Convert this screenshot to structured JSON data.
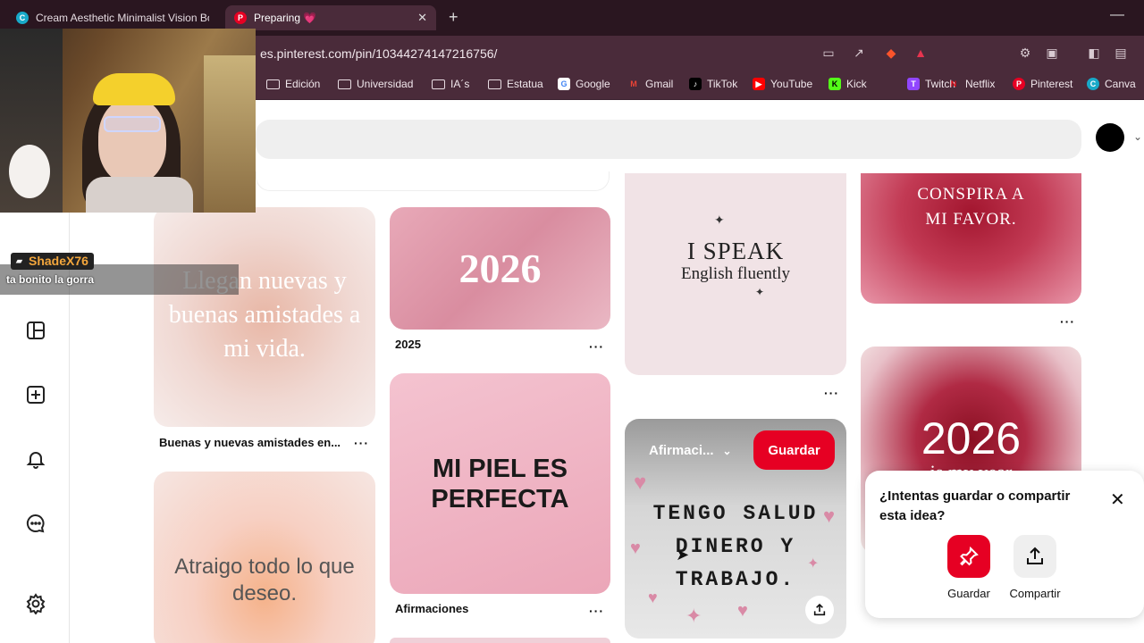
{
  "browser": {
    "tabs": [
      {
        "title": "Cream Aesthetic Minimalist Vision Bo",
        "favicon": "canva-icon",
        "active": false
      },
      {
        "title": "Preparing 💗",
        "favicon": "pinterest-icon",
        "active": true
      }
    ],
    "url": "es.pinterest.com/pin/10344274147216756/",
    "bookmarks": [
      {
        "label": "Edición",
        "icon": "folder-icon"
      },
      {
        "label": "Universidad",
        "icon": "folder-icon"
      },
      {
        "label": "IA´s",
        "icon": "folder-icon"
      },
      {
        "label": "Estatua",
        "icon": "folder-icon"
      },
      {
        "label": "Google",
        "icon": "google-icon"
      },
      {
        "label": "Gmail",
        "icon": "gmail-icon"
      },
      {
        "label": "TikTok",
        "icon": "tiktok-icon"
      },
      {
        "label": "YouTube",
        "icon": "youtube-icon"
      },
      {
        "label": "Kick",
        "icon": "kick-icon"
      },
      {
        "label": "Twitch",
        "icon": "twitch-icon"
      },
      {
        "label": "Netflix",
        "icon": "netflix-icon"
      },
      {
        "label": "Pinterest",
        "icon": "pinterest-icon"
      },
      {
        "label": "Canva",
        "icon": "canva-icon"
      }
    ]
  },
  "stream": {
    "chat_user": "ShadeX76",
    "chat_message": "ta bonito la gorra"
  },
  "pins": {
    "amistades": {
      "text": "Llegan nuevas y buenas amistades a mi vida.",
      "label": "Buenas y nuevas amistades en..."
    },
    "atraigo": {
      "text": "Atraigo todo lo que deseo."
    },
    "year2026": {
      "text": "2026",
      "label": "2025"
    },
    "piel": {
      "text": "MI PIEL ES PERFECTA",
      "label": "Afirmaciones"
    },
    "speak": {
      "line1": "I SPEAK",
      "line2": "English fluently"
    },
    "salud": {
      "text": "TENGO SALUD DINERO Y TRABAJO.",
      "board": "Afirmaci...",
      "save": "Guardar"
    },
    "conspira": {
      "text": "CONSPIRA A MI FAVOR."
    },
    "myyear": {
      "big": "2026",
      "small": "is my year"
    }
  },
  "popup": {
    "question": "¿Intentas guardar o compartir esta idea?",
    "save_label": "Guardar",
    "share_label": "Compartir"
  },
  "colors": {
    "pinterest_red": "#e60023",
    "chrome_bg": "#4a2b3a"
  }
}
